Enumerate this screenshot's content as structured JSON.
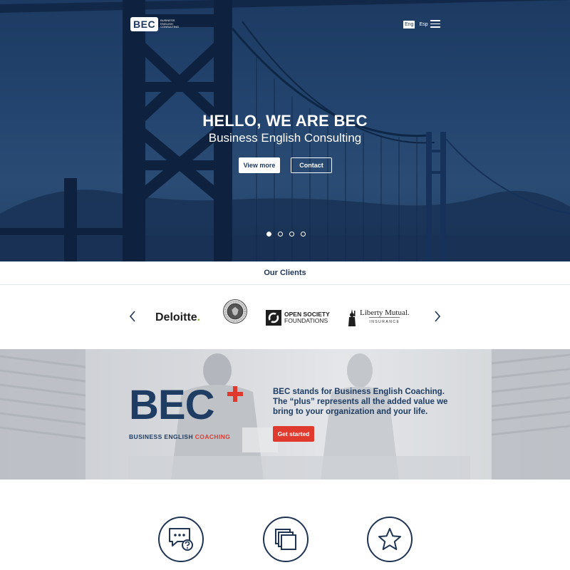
{
  "header": {
    "logo_mark": "BEC",
    "logo_tagline": "Business English Consulting",
    "lang_active": "Eng",
    "lang_other": "Esp"
  },
  "hero": {
    "title": "HELLO, WE ARE BEC",
    "subtitle": "Business English Consulting",
    "btn_view": "View more",
    "btn_contact": "Contact",
    "slides": 4,
    "active_slide": 1
  },
  "clients": {
    "title": "Our Clients",
    "items": [
      {
        "name": "Deloitte",
        "mark": "."
      },
      {
        "name": "United States of America Embassy seal"
      },
      {
        "line1": "OPEN SOCIETY",
        "line2": "FOUNDATIONS"
      },
      {
        "line1": "Liberty Mutual.",
        "line2": "INSURANCE"
      }
    ]
  },
  "bec_plus": {
    "logo_word": "BEC",
    "tag_part1": "BUSINESS ENGLISH ",
    "tag_part2": "COACHING",
    "description": "BEC stands for Business English Coaching. The “plus” represents all the added value we bring to your organization and your life.",
    "btn_start": "Get started"
  },
  "features": [
    {
      "icon": "chat-question-icon"
    },
    {
      "icon": "stacked-squares-icon"
    },
    {
      "icon": "star-icon"
    }
  ],
  "colors": {
    "navy": "#1f3553",
    "hero_blue": "#23456f",
    "red": "#e03a2f",
    "deloitte_green": "#86bc25"
  }
}
